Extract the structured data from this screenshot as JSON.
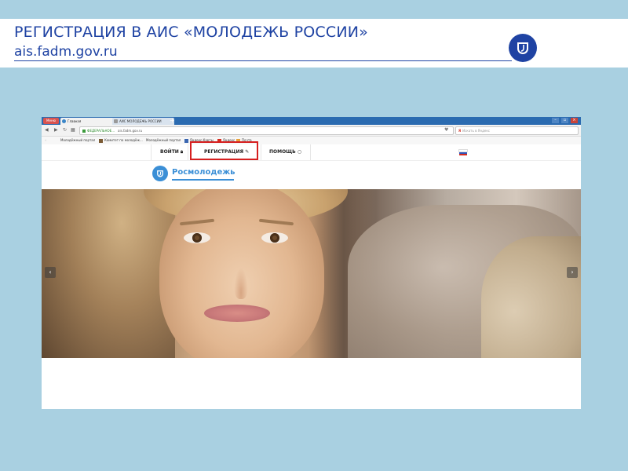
{
  "slide": {
    "title": "РЕГИСТРАЦИЯ В АИС «МОЛОДЕЖЬ РОССИИ»",
    "subtitle": "ais.fadm.gov.ru"
  },
  "browser": {
    "menu_label": "Меню",
    "tabs": [
      {
        "label": "Главная",
        "active": true
      },
      {
        "label": "АИС МОЛОДЕЖЬ РОССИИ",
        "active": false
      }
    ],
    "new_tab": "+",
    "url_secure_label": "ФЕДЕРАЛЬНОЕ...",
    "url": "ais.fadm.gov.ru",
    "search_placeholder": "Искать в Яндекс",
    "bookmarks": [
      "Молодёжный портал",
      "Комитет по молодёж...",
      "Молодёжный портал",
      "Яндекс.Карты",
      "Яндекс",
      "Почта"
    ]
  },
  "site": {
    "nav": {
      "login": "ВОЙТИ",
      "register": "РЕГИСТРАЦИЯ",
      "help": "ПОМОЩЬ"
    },
    "brand": "Росмолодежь",
    "slider": {
      "prev": "‹",
      "next": "›"
    }
  },
  "colors": {
    "slide_bg": "#a9d0e1",
    "title_blue": "#1f43a3",
    "brand_blue": "#3b8fd6",
    "highlight_red": "#d61f1f"
  }
}
